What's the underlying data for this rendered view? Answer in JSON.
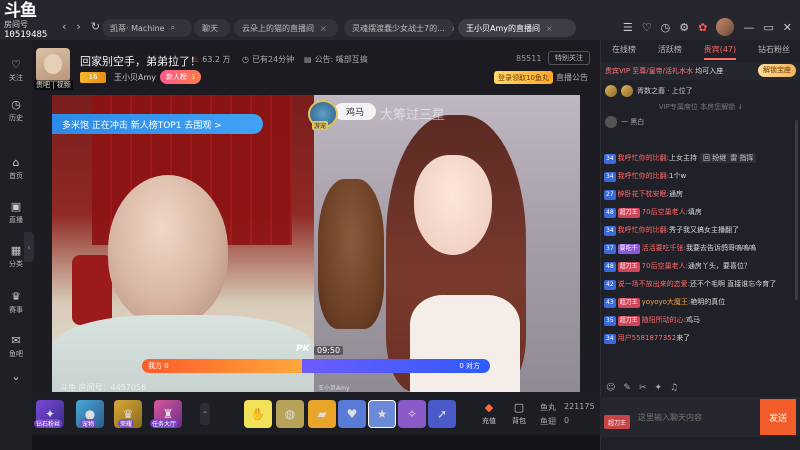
{
  "logo": {
    "mark": "斗鱼",
    "room_label": "房间号",
    "room_number": "10519485"
  },
  "tabs": [
    {
      "label": "凯蒂· Machine",
      "active": false
    },
    {
      "label": "聊天",
      "active": false
    },
    {
      "label": "云朵上的猫的直播间",
      "active": false
    },
    {
      "label": "灵魂摆渡蠢少女战士7的...",
      "active": false
    },
    {
      "label": "王小贝Amy的直播间",
      "active": true
    }
  ],
  "sidebar": [
    {
      "icon": "heart-icon",
      "label": "关注"
    },
    {
      "icon": "history-icon",
      "label": "历史"
    },
    {
      "icon": "home-icon",
      "label": "首页"
    },
    {
      "icon": "live-icon",
      "label": "直播"
    },
    {
      "icon": "category-icon",
      "label": "分类"
    },
    {
      "icon": "trophy-icon",
      "label": "赛事"
    },
    {
      "icon": "fishbar-icon",
      "label": "鱼吧"
    }
  ],
  "header": {
    "follow_label": "贵吧 | 视频",
    "title": "回家别空手，弟弟拉了！",
    "heat": "63.2 万",
    "fans": "已有24分钟",
    "announcement_short": "公告: 嘴部互搞",
    "room_id": "85511",
    "special_label": "特别关注",
    "level": "16",
    "host_name": "王小贝Amy",
    "new_badge_label": "新人榜",
    "new_badge_num": "1",
    "signin_label": "登录领取10鱼丸",
    "announce_label": "直播公告"
  },
  "video": {
    "promo_text": "多米饱 正在冲击 新人榜TOP1 去围观 >",
    "guest_name": "鸡马",
    "guest_role": "游宠",
    "watermark": "大筹过三星",
    "pk_label": "PK",
    "pk_time": "09:50",
    "pk_red_text": "我方 0",
    "pk_blue_text": "0 对方",
    "bottom_right": "王小贝Amy",
    "fish_id_label": "斗鱼 房间号：4457056"
  },
  "gifts": [
    {
      "icon": "wand-icon",
      "label": "钻石粉丝"
    },
    {
      "icon": "pet-icon",
      "label": "宠物"
    },
    {
      "icon": "trophy-icon",
      "label": "荣耀"
    },
    {
      "icon": "castle-icon",
      "label": "任务大厅"
    }
  ],
  "gift_items": [
    "荧光棒",
    "能量",
    "金条",
    "告白",
    "星星",
    "小鹿",
    "火箭"
  ],
  "actions": [
    {
      "icon": "recharge-icon",
      "label": "充值"
    },
    {
      "icon": "bag-icon",
      "label": "背包"
    }
  ],
  "balance": {
    "fish_label": "鱼丸",
    "fish_value": "221175",
    "coin_label": "鱼翅",
    "coin_value": "0"
  },
  "chat": {
    "tabs": [
      "在线榜",
      "活跃榜",
      "贵宾(47)",
      "钻石粉丝"
    ],
    "noble_text": "贵宾VIP 至尊/皇帝/活礼水水",
    "noble_bold": " 均可入座",
    "unlock_label": "解锁宝座",
    "rank_text": "胥数之裔 · 上位了",
    "vip_note": "VIP专属席位 本房您解锁 ↓",
    "white_row": "一 黑白",
    "messages": [
      {
        "lv": "34",
        "user": "我呼忙你的比翻:",
        "text": "上女主持",
        "fan": ""
      },
      {
        "lv": "34",
        "user": "我呼忙你的比翻:",
        "text": "1个w",
        "fan": ""
      },
      {
        "lv": "27",
        "user": "醉卧花下枕安眠:",
        "text": "通房",
        "fan": ""
      },
      {
        "lv": "48",
        "user": "70后空巢老人:",
        "text": "填房",
        "fan": "超刀王"
      },
      {
        "lv": "34",
        "user": "我呼忙你的比翻:",
        "text": "秀子我又搞女主播翻了",
        "fan": ""
      },
      {
        "lv": "37",
        "user": "活活要吃千张:",
        "text": "我要去告诉鸽哥嗚嗚嗚",
        "fan": "要吃千"
      },
      {
        "lv": "48",
        "user": "70后空巢老人:",
        "text": "通房丫头，要喜位？",
        "fan": "超刀王"
      },
      {
        "lv": "42",
        "user": "说一场不放出来的恋爱:",
        "text": "还不个毛啊 直接谁忘今育了",
        "fan": ""
      },
      {
        "lv": "43",
        "user": "yoyoyo大魔王:",
        "text": "艳明的真位",
        "fan": "超刀王"
      },
      {
        "lv": "35",
        "user": "随阳所动的心:",
        "text": "鸡马",
        "fan": "超刀王"
      },
      {
        "lv": "34",
        "user": "用户5581877352",
        "text": "来了",
        "fan": ""
      }
    ],
    "msg_actions": [
      "回 纷继",
      "雷 指挥"
    ],
    "toolbar": [
      "☺",
      "✎",
      "✂",
      "✦",
      "♫"
    ],
    "badge": "超刀王",
    "input_placeholder": "这里输入聊天内容",
    "send_label": "发送"
  }
}
